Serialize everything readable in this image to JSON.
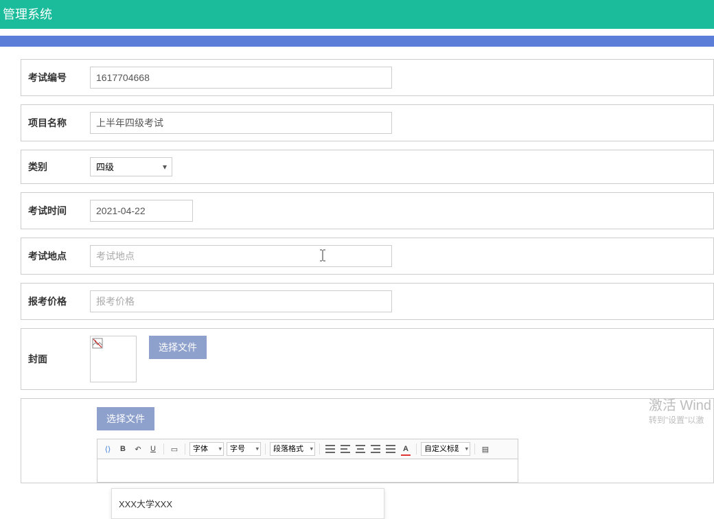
{
  "header": {
    "title": "管理系统"
  },
  "labels": {
    "exam_id": "考试编号",
    "project_name": "项目名称",
    "category": "类别",
    "exam_time": "考试时间",
    "exam_location": "考试地点",
    "price": "报考价格",
    "cover": "封面"
  },
  "values": {
    "exam_id": "1617704668",
    "project_name": "上半年四级考试",
    "category": "四级",
    "exam_time": "2021-04-22",
    "exam_location": "",
    "price": ""
  },
  "placeholders": {
    "exam_location": "考试地点",
    "price": "报考价格"
  },
  "suggestions": [
    "XXX大学XXX"
  ],
  "buttons": {
    "choose_file": "选择文件"
  },
  "editor_toolbar": {
    "font": "字体",
    "size": "字号",
    "para": "段落格式",
    "custom": "自定义标题"
  },
  "watermark": {
    "line1": "激活 Wind",
    "line2": "转到\"设置\"以激"
  }
}
